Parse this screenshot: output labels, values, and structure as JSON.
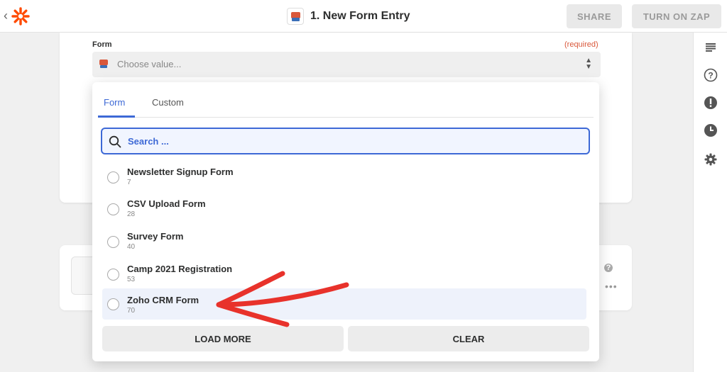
{
  "header": {
    "title": "1. New Form Entry",
    "share_label": "SHARE",
    "turn_on_label": "TURN ON ZAP",
    "brand_color": "#ff4a00"
  },
  "field": {
    "label": "Form",
    "required_label": "(required)",
    "placeholder": "Choose value..."
  },
  "dropdown": {
    "tabs": [
      {
        "label": "Form",
        "active": true
      },
      {
        "label": "Custom",
        "active": false
      }
    ],
    "search_placeholder": "Search ...",
    "options": [
      {
        "label": "Newsletter Signup Form",
        "id": "7"
      },
      {
        "label": "CSV Upload Form",
        "id": "28"
      },
      {
        "label": "Survey Form",
        "id": "40"
      },
      {
        "label": "Camp 2021 Registration",
        "id": "53"
      },
      {
        "label": "Zoho CRM Form",
        "id": "70"
      }
    ],
    "load_more_label": "LOAD MORE",
    "clear_label": "CLEAR"
  },
  "sidebar_icons": [
    "list-icon",
    "help-icon",
    "alert-icon",
    "clock-icon",
    "gear-icon"
  ],
  "colors": {
    "accent": "#3d69d6",
    "required": "#d9583b",
    "annotation_arrow": "#e8322b"
  }
}
